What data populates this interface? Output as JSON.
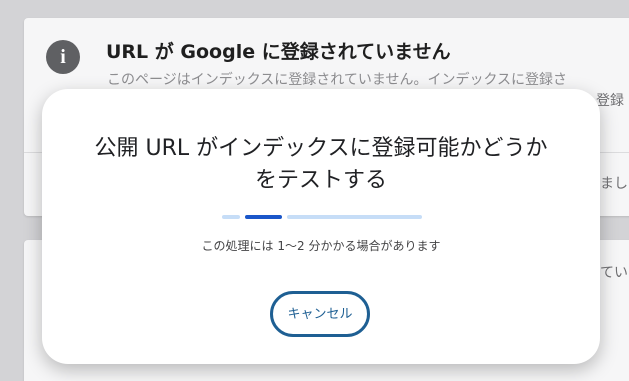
{
  "background": {
    "card_title": "URL が Google に登録されていません",
    "card_description": "このページはインデックスに登録されていません。インデックスに登録さ",
    "info_icon": "info-icon",
    "fragments": [
      "登録",
      "まし",
      "てい"
    ]
  },
  "dialog": {
    "title_line1": "公開 URL がインデックスに登録可能かどうか",
    "title_line2": "をテストする",
    "progress_indicator": "indeterminate",
    "note": "この処理には 1〜2 分かかる場合があります",
    "cancel_label": "キャンセル"
  },
  "colors": {
    "accent": "#1a56c9",
    "button_border": "#1e5f93",
    "progress_track": "#c6ddf7"
  }
}
